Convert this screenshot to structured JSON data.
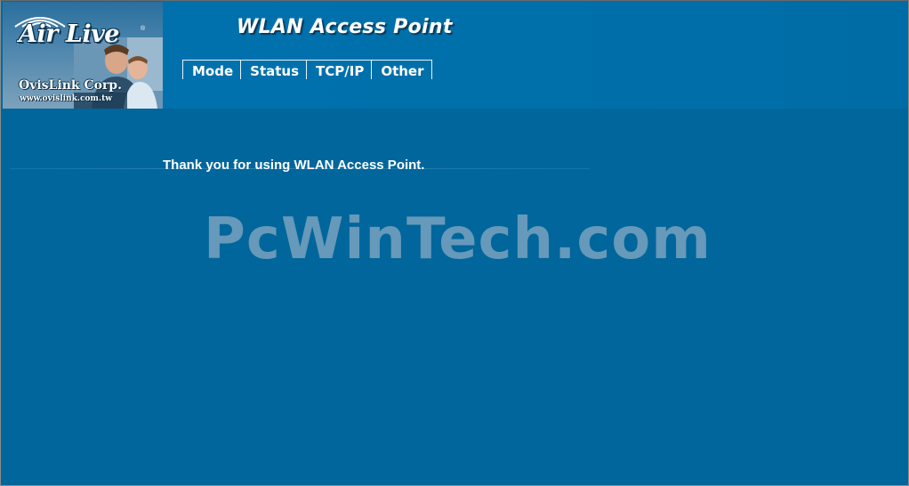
{
  "logo": {
    "brand": "Air Live",
    "registered": "®",
    "company": "OvisLink Corp.",
    "url": "www.ovislink.com.tw"
  },
  "header": {
    "title": "WLAN Access Point"
  },
  "nav": {
    "items": [
      {
        "label": "Mode"
      },
      {
        "label": "Status"
      },
      {
        "label": "TCP/IP"
      },
      {
        "label": "Other"
      }
    ]
  },
  "main": {
    "message": "Thank you for using WLAN Access Point."
  },
  "watermark": {
    "text": "PcWinTech.com"
  },
  "colors": {
    "background": "#00669b",
    "header": "#006aa4",
    "text": "#ffffff",
    "watermark": "#6f9ebd"
  }
}
